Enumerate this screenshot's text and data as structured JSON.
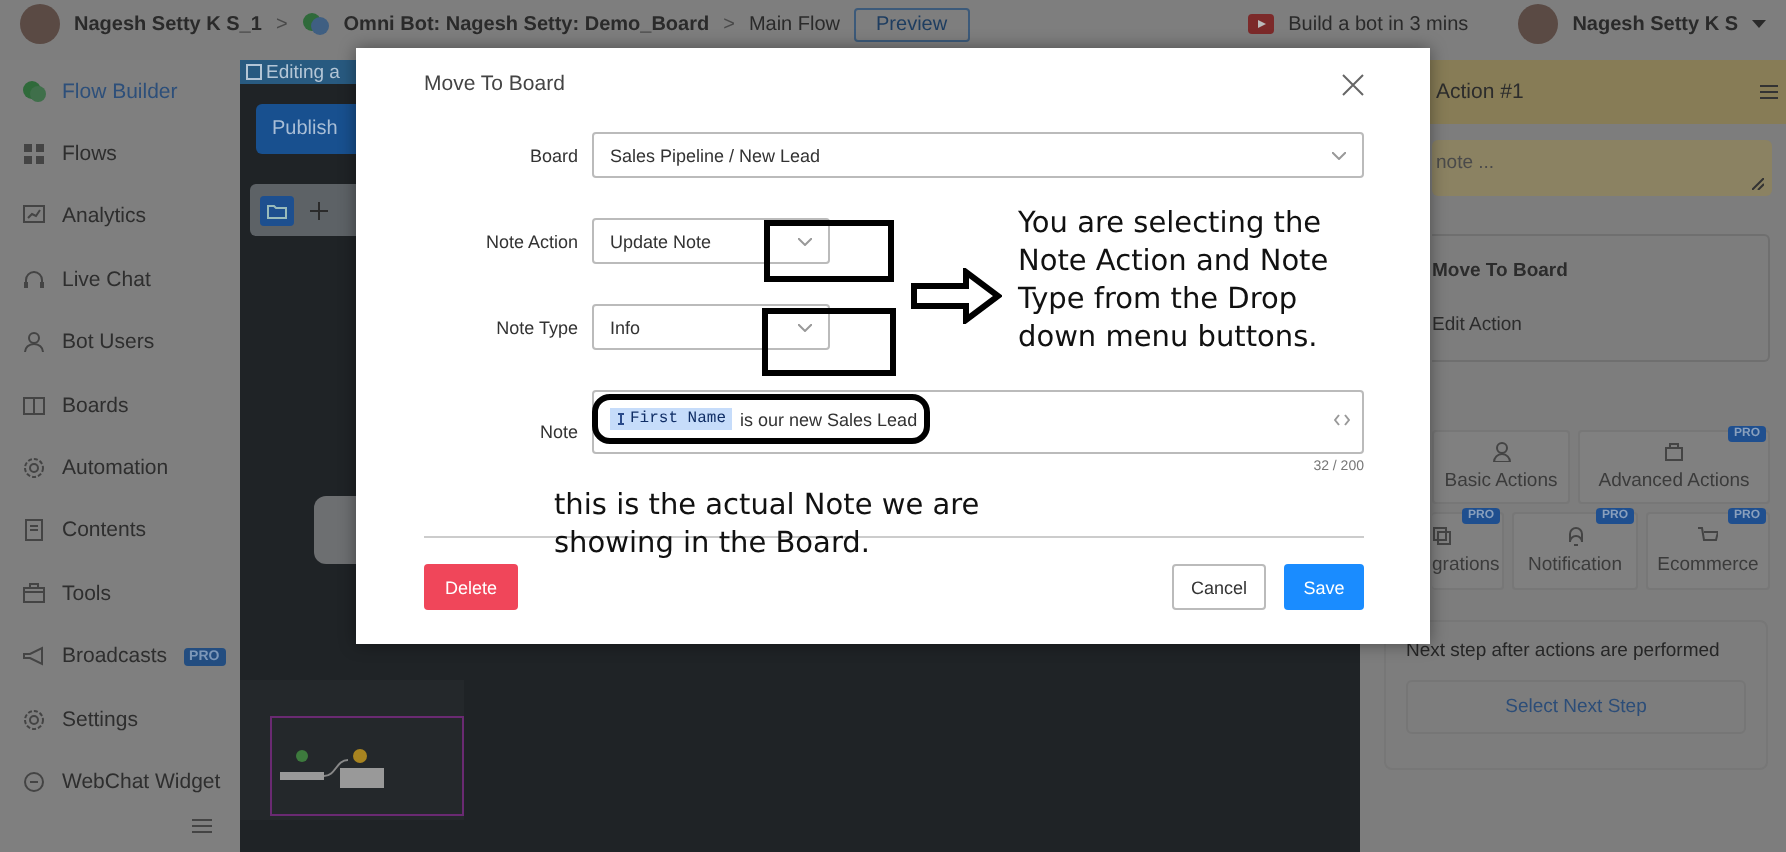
{
  "top_bar": {
    "account": "Nagesh Setty K S_1",
    "separator_1": ">",
    "bot": "Omni Bot: Nagesh Setty: Demo_Board",
    "separator_2": ">",
    "flow": "Main Flow",
    "preview_button": "Preview",
    "tutorial_link": "Build a bot in 3 mins",
    "user": "Nagesh Setty K S"
  },
  "sidebar": {
    "items": [
      {
        "label": "Flow Builder",
        "selected": true
      },
      {
        "label": "Flows",
        "selected": false
      },
      {
        "label": "Analytics",
        "selected": false
      },
      {
        "label": "Live Chat",
        "selected": false
      },
      {
        "label": "Bot Users",
        "selected": false
      },
      {
        "label": "Boards",
        "selected": false
      },
      {
        "label": "Automation",
        "selected": false
      },
      {
        "label": "Contents",
        "selected": false
      },
      {
        "label": "Tools",
        "selected": false
      },
      {
        "label": "Broadcasts",
        "selected": false,
        "badge": "PRO"
      },
      {
        "label": "Settings",
        "selected": false
      },
      {
        "label": "WebChat Widget",
        "selected": false
      }
    ]
  },
  "canvas": {
    "banner": "Editing a",
    "publish_button": "Publish"
  },
  "right_panel": {
    "title": "Action #1",
    "note_placeholder": "note ...",
    "action_card": {
      "title": "Move To Board",
      "link": "Edit Action"
    },
    "tiles": [
      {
        "label": "Basic Actions"
      },
      {
        "label": "Advanced Actions",
        "badge": "PRO"
      },
      {
        "label": "grations",
        "badge": "PRO"
      },
      {
        "label": "Notification",
        "badge": "PRO"
      },
      {
        "label": "Ecommerce",
        "badge": "PRO"
      }
    ],
    "next_step": {
      "text": "Next step after actions are performed",
      "button": "Select Next Step"
    }
  },
  "dialog": {
    "title": "Move To Board",
    "fields": [
      {
        "label": "Board",
        "kind": "select",
        "value": "Sales Pipeline / New Lead"
      },
      {
        "label": "Note Action",
        "kind": "select",
        "value": "Update Note"
      },
      {
        "label": "Note Type",
        "kind": "select",
        "value": "Info"
      },
      {
        "label": "Note",
        "kind": "textarea",
        "token": "First Name",
        "value": "is our new Sales Lead",
        "counter": "32 / 200"
      }
    ],
    "delete_button": "Delete",
    "cancel_button": "Cancel",
    "save_button": "Save"
  },
  "annotations": [
    {
      "text": "You are selecting the Note Action and Note Type from the Drop down menu buttons."
    },
    {
      "text": "this is the actual Note we are showing in the Board."
    }
  ]
}
